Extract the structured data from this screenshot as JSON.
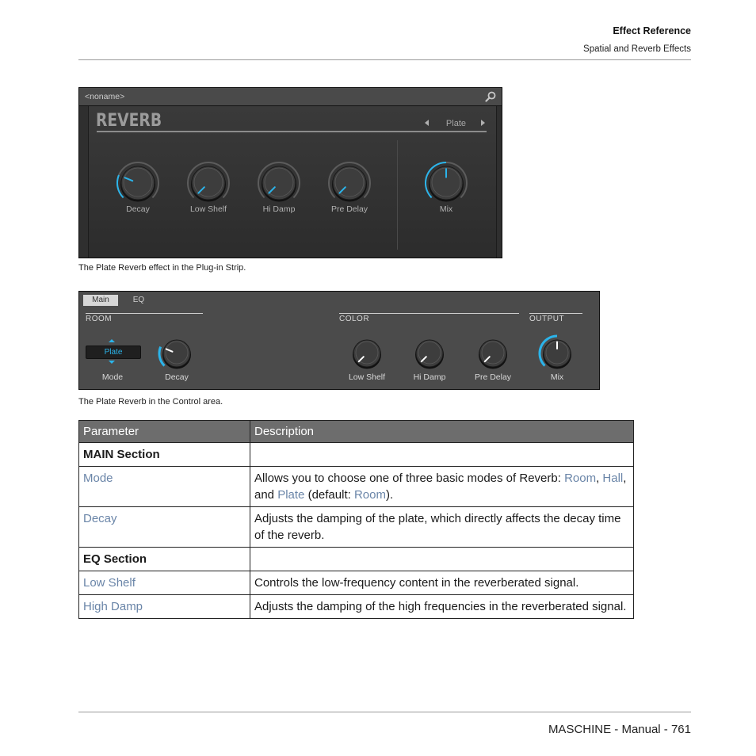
{
  "header": {
    "title": "Effect Reference",
    "subtitle": "Spatial and Reverb Effects"
  },
  "plugin_strip": {
    "name_field": "<noname>",
    "search_icon": "search-icon",
    "effect_title": "REVERB",
    "preset": "Plate",
    "knobs": [
      {
        "label": "Decay",
        "value": 0.25
      },
      {
        "label": "Low Shelf",
        "value": 0.0
      },
      {
        "label": "Hi Damp",
        "value": 0.0
      },
      {
        "label": "Pre Delay",
        "value": 0.0
      },
      {
        "label": "Mix",
        "value": 0.5
      }
    ],
    "caption": "The Plate Reverb effect in the Plug-in Strip."
  },
  "control_area": {
    "tabs": [
      {
        "label": "Main",
        "active": true
      },
      {
        "label": "EQ",
        "active": false
      }
    ],
    "sections": {
      "room": "ROOM",
      "color": "COLOR",
      "output": "OUTPUT"
    },
    "mode": {
      "label": "Mode",
      "value": "Plate"
    },
    "knobs": [
      {
        "label": "Decay",
        "value": 0.25
      },
      {
        "label": "Low Shelf",
        "value": 0.0
      },
      {
        "label": "Hi Damp",
        "value": 0.0
      },
      {
        "label": "Pre Delay",
        "value": 0.0
      },
      {
        "label": "Mix",
        "value": 0.5
      }
    ],
    "caption": "The Plate Reverb in the Control area."
  },
  "table": {
    "headers": [
      "Parameter",
      "Description"
    ],
    "rows": [
      {
        "type": "section",
        "param": "MAIN Section",
        "desc": ""
      },
      {
        "type": "param",
        "param": "Mode",
        "desc_parts": [
          {
            "t": "Allows you to choose one of three basic modes of Reverb: "
          },
          {
            "t": "Room",
            "link": true
          },
          {
            "t": ", "
          },
          {
            "t": "Hall",
            "link": true
          },
          {
            "t": ", and "
          },
          {
            "t": "Plate",
            "link": true
          },
          {
            "t": " (default: "
          },
          {
            "t": "Room",
            "link": true
          },
          {
            "t": ")."
          }
        ]
      },
      {
        "type": "param",
        "param": "Decay",
        "desc_parts": [
          {
            "t": "Adjusts the damping of the plate, which directly affects the decay time of the reverb."
          }
        ]
      },
      {
        "type": "section",
        "param": "EQ Section",
        "desc": ""
      },
      {
        "type": "param",
        "param": "Low Shelf",
        "desc_parts": [
          {
            "t": "Controls the low-frequency content in the reverberated signal."
          }
        ]
      },
      {
        "type": "param",
        "param": "High Damp",
        "desc_parts": [
          {
            "t": "Adjusts the damping of the high frequencies in the reverberated signal."
          }
        ]
      }
    ]
  },
  "footer": {
    "text": "MASCHINE - Manual - 761"
  },
  "colors": {
    "accent": "#2bb4ea",
    "link": "#6a85a8",
    "table_header": "#6d6d6d"
  }
}
